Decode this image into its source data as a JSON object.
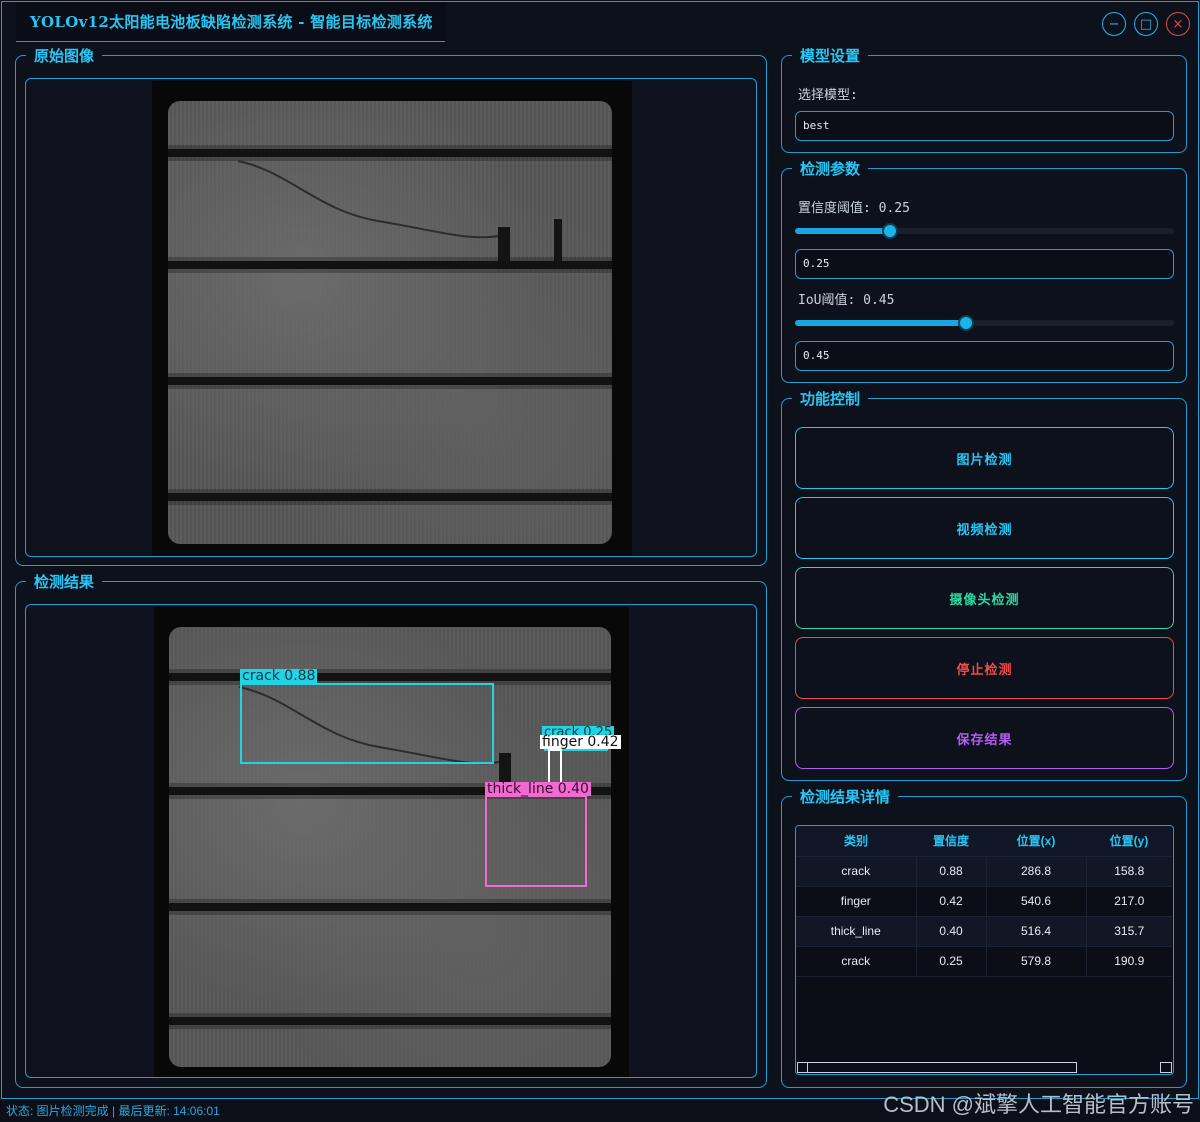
{
  "window": {
    "title": "YOLOv12太阳能电池板缺陷检测系统 - 智能目标检测系统",
    "minimize_symbol": "−",
    "maximize_symbol": "□",
    "close_symbol": "×"
  },
  "panels": {
    "original": {
      "title": "原始图像"
    },
    "result": {
      "title": "检测结果"
    },
    "model": {
      "title": "模型设置",
      "select_label": "选择模型:",
      "selected_model": "best"
    },
    "params": {
      "title": "检测参数",
      "conf_label": "置信度阈值: 0.25",
      "conf_value": "0.25",
      "conf_level": 0.25,
      "iou_label": "IoU阈值: 0.45",
      "iou_value": "0.45",
      "iou_level": 0.45
    },
    "controls": {
      "title": "功能控制",
      "buttons": [
        {
          "label": "图片检测",
          "color": "#27c6f5"
        },
        {
          "label": "视频检测",
          "color": "#27c6f5"
        },
        {
          "label": "摄像头检测",
          "color": "#2ed8a3"
        },
        {
          "label": "停止检测",
          "color": "#f04a4a"
        },
        {
          "label": "保存结果",
          "color": "#b25cf0"
        }
      ]
    },
    "details": {
      "title": "检测结果详情",
      "columns": [
        "类别",
        "置信度",
        "位置(x)",
        "位置(y)"
      ],
      "rows": [
        [
          "crack",
          "0.88",
          "286.8",
          "158.8"
        ],
        [
          "finger",
          "0.42",
          "540.6",
          "217.0"
        ],
        [
          "thick_line",
          "0.40",
          "516.4",
          "315.7"
        ],
        [
          "crack",
          "0.25",
          "579.8",
          "190.9"
        ]
      ]
    }
  },
  "detections": [
    {
      "label": "crack 0.88",
      "color": "#22d3e6"
    },
    {
      "label": "crack 0.25",
      "color": "#22d3e6"
    },
    {
      "label": "finger 0.42",
      "color": "#ffffff"
    },
    {
      "label": "thick_line 0.40",
      "color": "#f06ad0"
    }
  ],
  "status": {
    "text": "状态: 图片检测完成 | 最后更新: 14:06:01"
  },
  "watermark": "CSDN @斌擎人工智能官方账号"
}
